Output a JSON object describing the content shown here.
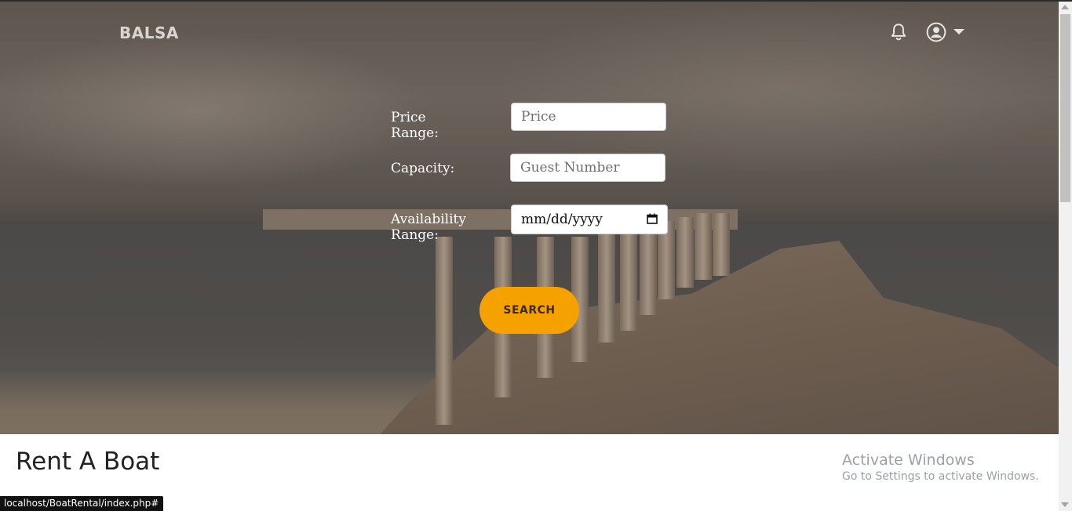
{
  "header": {
    "brand": "BALSA",
    "icons": [
      "bell-icon",
      "user-icon",
      "caret-down-icon"
    ]
  },
  "search_form": {
    "price_label": "Price Range:",
    "price_placeholder": "Price",
    "capacity_label": "Capacity:",
    "capacity_placeholder": "Guest Number",
    "availability_label": "Availability Range:",
    "availability_value": "mm/dd/yyyy",
    "search_button": "SEARCH"
  },
  "section": {
    "title": "Rent A Boat"
  },
  "watermark": {
    "line1": "Activate Windows",
    "line2": "Go to Settings to activate Windows."
  },
  "status_bar": {
    "url": "localhost/BoatRental/index.php#"
  },
  "colors": {
    "accent": "#f5a200",
    "hero_overlay": "#5e554f"
  }
}
